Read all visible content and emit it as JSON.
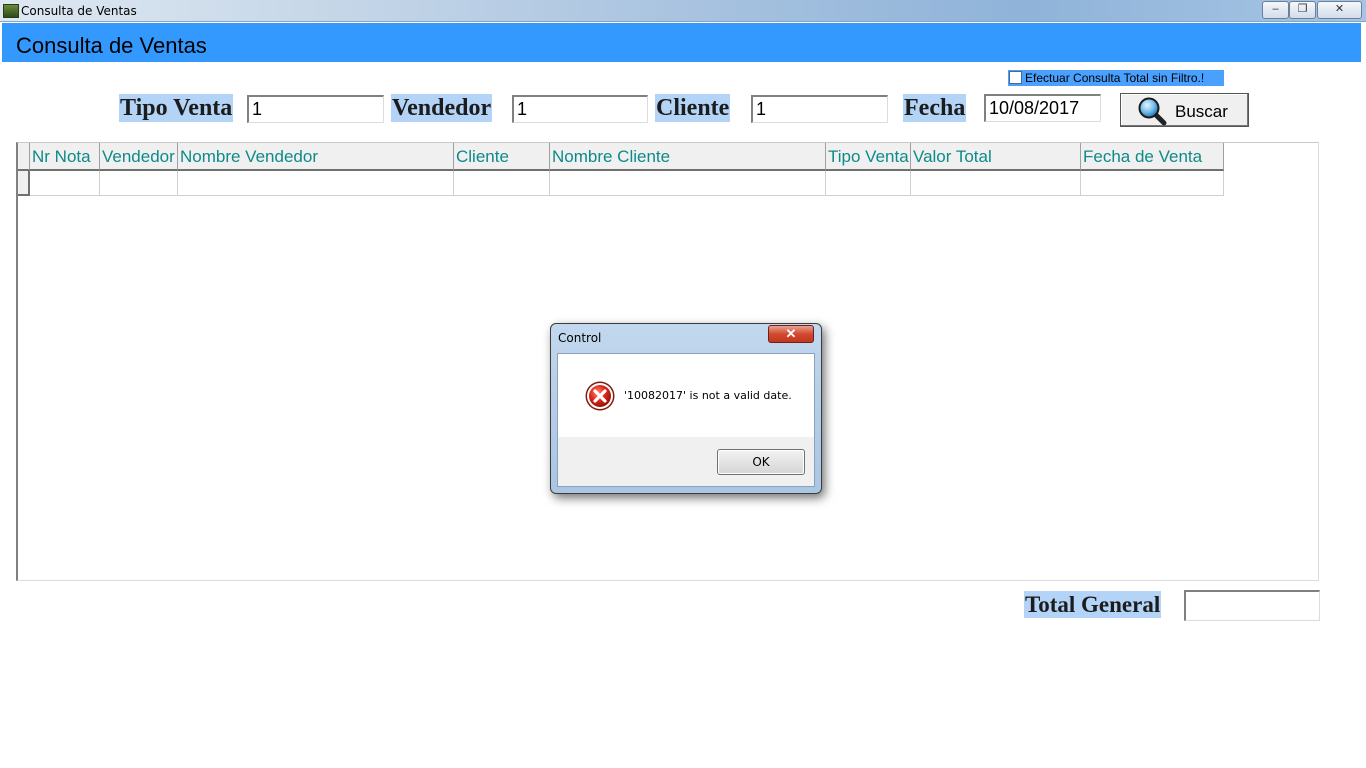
{
  "window": {
    "title": "Consulta de Ventas",
    "controls": {
      "minimize": "–",
      "maximize": "❐",
      "close": "✕"
    }
  },
  "header": {
    "title": "Consulta de Ventas"
  },
  "filter_all": {
    "label": "Efectuar Consulta Total sin Filtro.!",
    "checked": false
  },
  "filters": {
    "tipo_venta": {
      "label": "Tipo Venta",
      "value": "1"
    },
    "vendedor": {
      "label": "Vendedor",
      "value": "1"
    },
    "cliente": {
      "label": "Cliente",
      "value": "1"
    },
    "fecha": {
      "label": "Fecha",
      "value": "10/08/2017"
    }
  },
  "search_button": {
    "label": "Buscar",
    "icon": "magnifier-icon"
  },
  "grid": {
    "columns": [
      "Nr Nota",
      "Vendedor",
      "Nombre Vendedor",
      "Cliente",
      "Nombre Cliente",
      "Tipo Venta",
      "Valor Total",
      "Fecha de Venta"
    ],
    "rows": []
  },
  "total": {
    "label": "Total General",
    "value": ""
  },
  "dialog": {
    "title": "Control",
    "message": "'10082017' is not a valid date.",
    "ok_label": "OK",
    "close_glyph": "✕",
    "icon": "error-icon"
  },
  "colors": {
    "header_bg": "#3399ff",
    "label_bg": "#b3d4f7",
    "column_text": "#0e8a8a"
  }
}
